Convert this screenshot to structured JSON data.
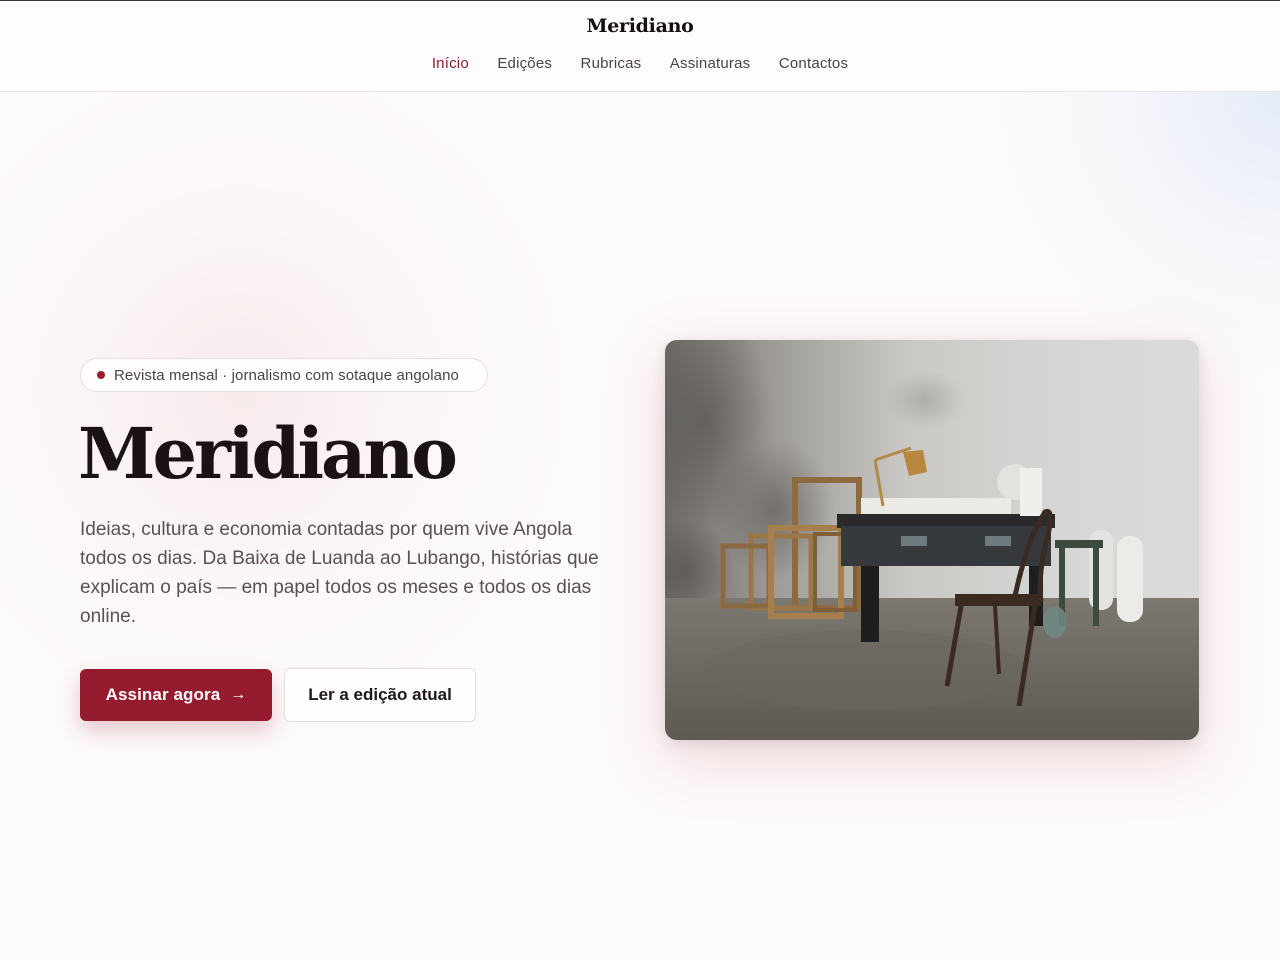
{
  "brand": "Meridiano",
  "nav": {
    "items": [
      "Início",
      "Edições",
      "Rubricas",
      "Assinaturas",
      "Contactos"
    ],
    "active": "Início"
  },
  "hero": {
    "tagline": "Revista mensal · jornalismo com sotaque angolano",
    "title": "Meridiano",
    "lead": "Ideias, cultura e economia contadas por quem vive Angola todos os dias. Da Baixa de Luanda ao Lubango, histórias que explicam o país — em papel todos os meses e todos os dias online.",
    "primary_cta": "Assinar agora",
    "primary_cta_icon": "arrow-right-icon",
    "secondary_cta": "Ler a edição atual"
  },
  "colors": {
    "accent": "#951b2e",
    "nav_active": "#8c1d2e",
    "text_dark": "#1b1214",
    "text_muted": "#5a5154"
  }
}
